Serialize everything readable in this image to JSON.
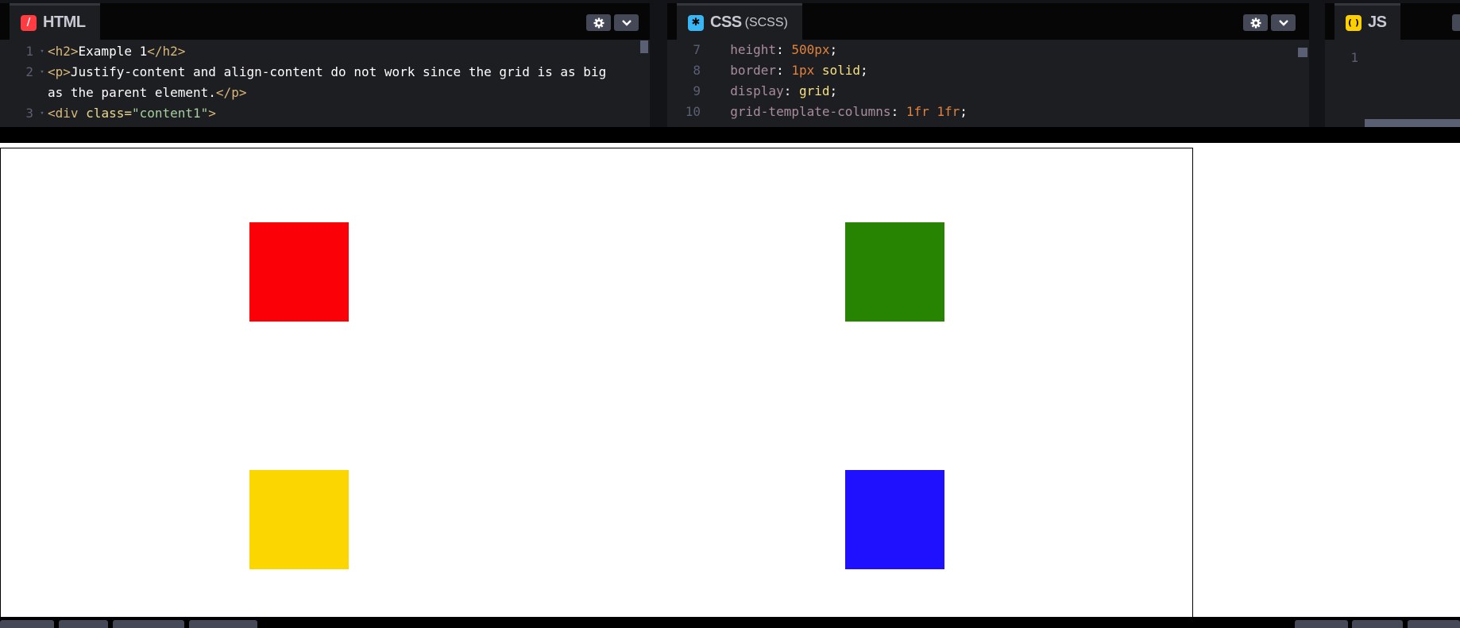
{
  "html_pane": {
    "title": "HTML",
    "icon": "html-logo-icon",
    "icon_color": "#ff3c41",
    "code": [
      {
        "ln": "1",
        "fold": "▾",
        "tokens": [
          [
            "tag",
            "<h2>"
          ],
          [
            "text",
            "Example 1"
          ],
          [
            "tag",
            "</h2>"
          ]
        ]
      },
      {
        "ln": "2",
        "fold": "▾",
        "tokens": [
          [
            "tag",
            "<p>"
          ],
          [
            "text",
            "Justify-content and align-content do not work since the grid is as big"
          ]
        ]
      },
      {
        "ln": "",
        "fold": "",
        "tokens": [
          [
            "text",
            "as the parent element."
          ],
          [
            "tag",
            "</p>"
          ]
        ]
      },
      {
        "ln": "3",
        "fold": "▾",
        "tokens": [
          [
            "tag",
            "<div "
          ],
          [
            "attr",
            "class="
          ],
          [
            "str",
            "\"content1\""
          ],
          [
            "tag",
            ">"
          ]
        ]
      }
    ]
  },
  "css_pane": {
    "title": "CSS",
    "subtitle": "(SCSS)",
    "icon": "scss-logo-icon",
    "icon_color": "#47cf73",
    "code": [
      {
        "ln": "7",
        "fold": "",
        "tokens": [
          [
            "prop",
            "  height"
          ],
          [
            "punc",
            ": "
          ],
          [
            "num",
            "500px"
          ],
          [
            "punc",
            ";"
          ]
        ]
      },
      {
        "ln": "8",
        "fold": "",
        "tokens": [
          [
            "prop",
            "  border"
          ],
          [
            "punc",
            ": "
          ],
          [
            "num",
            "1px"
          ],
          [
            "punc",
            " "
          ],
          [
            "kw",
            "solid"
          ],
          [
            "punc",
            ";"
          ]
        ]
      },
      {
        "ln": "9",
        "fold": "",
        "tokens": [
          [
            "prop",
            "  display"
          ],
          [
            "punc",
            ": "
          ],
          [
            "kw",
            "grid"
          ],
          [
            "punc",
            ";"
          ]
        ]
      },
      {
        "ln": "10",
        "fold": "",
        "tokens": [
          [
            "prop",
            "  grid-template-columns"
          ],
          [
            "punc",
            ": "
          ],
          [
            "num",
            "1fr 1fr"
          ],
          [
            "punc",
            ";"
          ]
        ]
      }
    ]
  },
  "js_pane": {
    "title": "JS",
    "icon": "js-logo-icon",
    "icon_color": "#fcd000",
    "code": [
      {
        "ln": "1",
        "fold": "",
        "tokens": []
      }
    ]
  },
  "preview": {
    "squares": [
      {
        "name": "red-square",
        "color": "#fb0006"
      },
      {
        "name": "green-square",
        "color": "#268402"
      },
      {
        "name": "yellow-square",
        "color": "#fcd600"
      },
      {
        "name": "blue-square",
        "color": "#1f10fd"
      }
    ]
  }
}
